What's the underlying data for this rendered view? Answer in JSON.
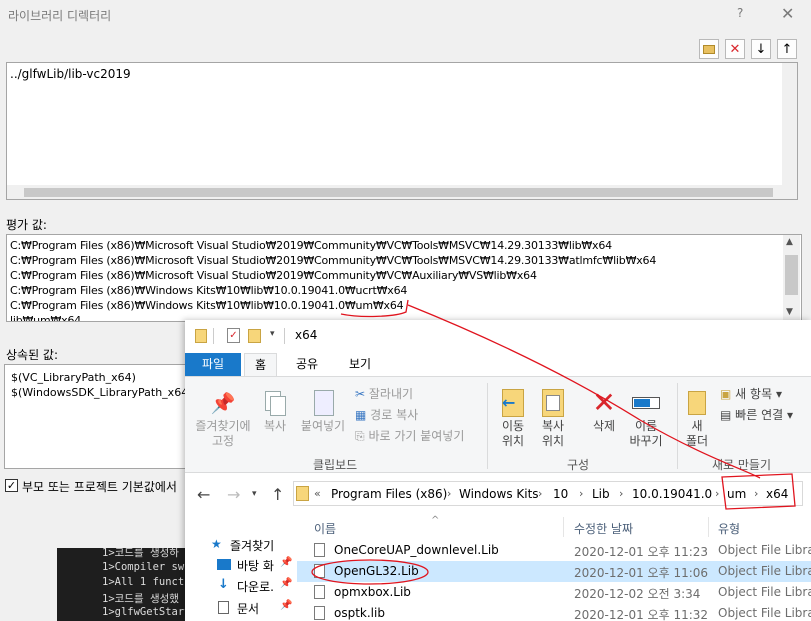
{
  "dialog": {
    "title": "라이브러리 디렉터리",
    "help": "?",
    "close": "✕",
    "directory_value": "../glfwLib/lib-vc2019",
    "eval_label": "평가 값:",
    "eval_lines": [
      "C:₩Program Files (x86)₩Microsoft Visual Studio₩2019₩Community₩VC₩Tools₩MSVC₩14.29.30133₩lib₩x64",
      "C:₩Program Files (x86)₩Microsoft Visual Studio₩2019₩Community₩VC₩Tools₩MSVC₩14.29.30133₩atlmfc₩lib₩x64",
      "C:₩Program Files (x86)₩Microsoft Visual Studio₩2019₩Community₩VC₩Auxiliary₩VS₩lib₩x64",
      "C:₩Program Files (x86)₩Windows Kits₩10₩lib₩10.0.19041.0₩ucrt₩x64",
      "C:₩Program Files (x86)₩Windows Kits₩10₩lib₩10.0.19041.0₩um₩x64",
      "lib₩um₩x64"
    ],
    "inherited_label": "상속된 값:",
    "inherited_lines": [
      "$(VC_LibraryPath_x64)",
      "$(WindowsSDK_LibraryPath_x64)"
    ],
    "checkbox_label": "부모 또는 프로젝트 기본값에서"
  },
  "console": {
    "lines": [
      "1>코드를 생성하",
      "1>Compiler swi",
      "1>All 1 functi",
      "1>코드를 생성했",
      "1>glfwGetStart"
    ]
  },
  "explorer": {
    "window_title": "x64",
    "tabs": {
      "file": "파일",
      "home": "홈",
      "share": "공유",
      "view": "보기"
    },
    "clipboard": {
      "pin": "즐겨찾기에\n고정",
      "copy": "복사",
      "paste": "붙여넣기",
      "cut": "잘라내기",
      "copy_path": "경로 복사",
      "paste_shortcut": "바로 가기 붙여넣기",
      "group": "클립보드"
    },
    "organize": {
      "move": "이동\n위치",
      "copy_to": "복사\n위치",
      "delete": "삭제",
      "rename": "이름\n바꾸기",
      "group": "구성"
    },
    "new": {
      "folder": "새\n폴더",
      "new_item": "새 항목",
      "easy_access": "빠른 연결",
      "group": "새로 만들기"
    },
    "breadcrumb": [
      "Program Files (x86)",
      "Windows Kits",
      "10",
      "Lib",
      "10.0.19041.0",
      "um",
      "x64"
    ],
    "nav_items": [
      "즐겨찾기",
      "바탕 화",
      "다운로.",
      "문서"
    ],
    "columns": {
      "name": "이름",
      "date": "수정한 날짜",
      "type": "유형"
    },
    "files": [
      {
        "name": "OneCoreUAP_downlevel.Lib",
        "date": "2020-12-01 오후 11:23",
        "type": "Object File Library"
      },
      {
        "name": "OpenGL32.Lib",
        "date": "2020-12-01 오후 11:06",
        "type": "Object File Library"
      },
      {
        "name": "opmxbox.Lib",
        "date": "2020-12-02 오전 3:34",
        "type": "Object File Library"
      },
      {
        "name": "osptk.lib",
        "date": "2020-12-01 오후 11:32",
        "type": "Object File Library"
      }
    ]
  },
  "colors": {
    "accent": "#1979ca",
    "selection": "#cce8ff",
    "annotation": "#e0141e",
    "delete": "#d9262c"
  }
}
